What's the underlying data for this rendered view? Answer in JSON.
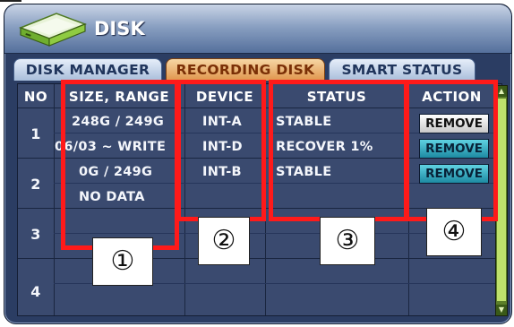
{
  "window": {
    "title": "DISK"
  },
  "tabs": [
    {
      "label": "DISK MANAGER",
      "active": false
    },
    {
      "label": "RECORDING DISK",
      "active": true
    },
    {
      "label": "SMART STATUS",
      "active": false
    }
  ],
  "table": {
    "headers": {
      "no": "NO",
      "size": "SIZE, RANGE",
      "device": "DEVICE",
      "status": "STATUS",
      "action": "ACTION"
    },
    "rows": [
      {
        "no": "1",
        "entries": [
          {
            "size": "248G / 249G",
            "device": "INT-A",
            "status": "STABLE",
            "action": "REMOVE",
            "style": "gray"
          },
          {
            "size": "06/03 ~ WRITE",
            "device": "INT-D",
            "status": "RECOVER 1%",
            "action": "REMOVE",
            "style": "teal"
          }
        ]
      },
      {
        "no": "2",
        "entries": [
          {
            "size": "0G / 249G",
            "device": "INT-B",
            "status": "STABLE",
            "action": "REMOVE",
            "style": "teal"
          },
          {
            "size": "NO DATA",
            "device": "",
            "status": "",
            "action": "",
            "style": ""
          }
        ]
      },
      {
        "no": "3",
        "entries": []
      },
      {
        "no": "4",
        "entries": []
      }
    ]
  },
  "callouts": [
    "①",
    "②",
    "③",
    "④"
  ],
  "colors": {
    "highlight": "#ff1a1a",
    "tab_active": "#e0954c",
    "button_teal": "#1d8aa2",
    "scrollbar": "#bfe16c"
  },
  "icons": {
    "disk": "disk-drive-icon",
    "scroll_up": "scroll-up-arrow-icon",
    "scroll_down": "scroll-down-arrow-icon"
  }
}
